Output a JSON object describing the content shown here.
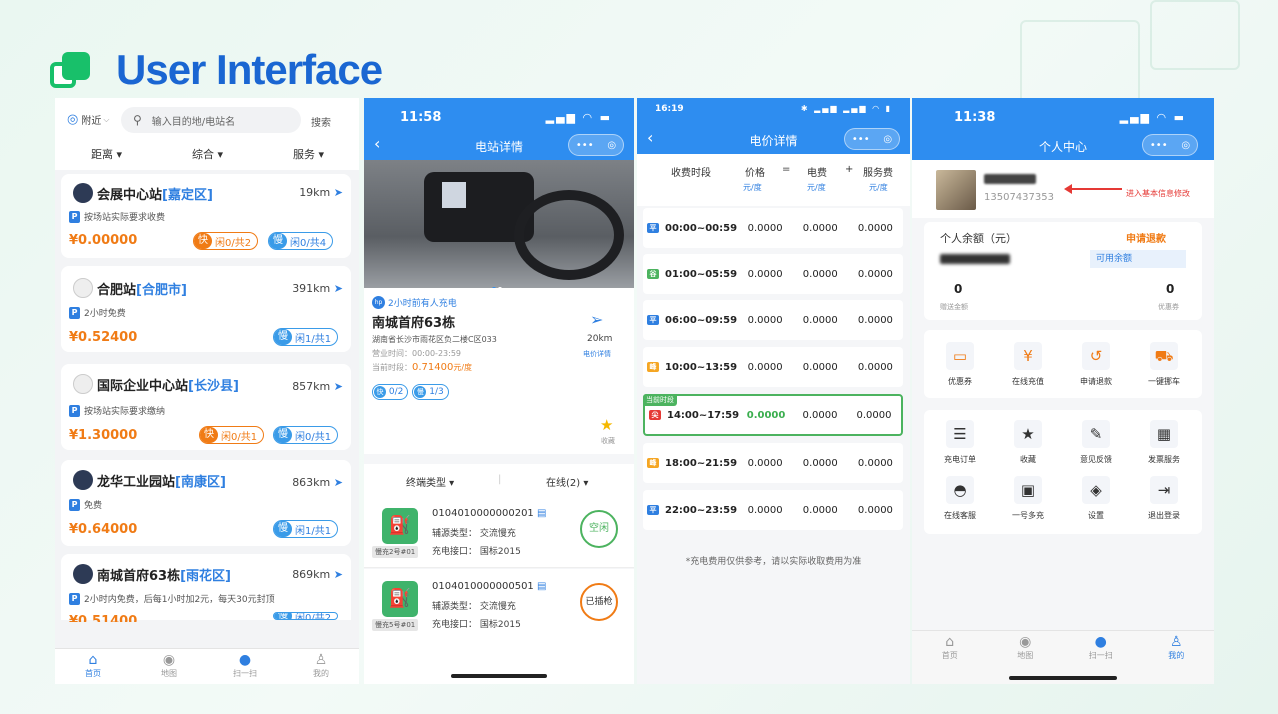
{
  "page_title": "User Interface",
  "colors": {
    "accent": "#2e8df0",
    "brand_green": "#18c06a",
    "title_blue": "#1a66d2",
    "price_orange": "#f07b15"
  },
  "p1": {
    "location": "附近",
    "search_placeholder": "输入目的地/电站名",
    "search_btn": "搜索",
    "filters": [
      "距离",
      "综合",
      "服务"
    ],
    "stations": [
      {
        "name": "会展中心站",
        "district": "[嘉定区]",
        "dist": "19km",
        "note": "按场站实际要求收费",
        "price": "¥0.00000",
        "fast": "闲0/共2",
        "slow": "闲0/共4"
      },
      {
        "name": "合肥站",
        "district": "[合肥市]",
        "dist": "391km",
        "note": "2小时免费",
        "price": "¥0.52400",
        "fast": "",
        "slow": "闲1/共1"
      },
      {
        "name": "国际企业中心站",
        "district": "[长沙县]",
        "dist": "857km",
        "note": "按场站实际要求缴纳",
        "price": "¥1.30000",
        "fast": "闲0/共1",
        "slow": "闲0/共1"
      },
      {
        "name": "龙华工业园站",
        "district": "[南康区]",
        "dist": "863km",
        "note": "免费",
        "price": "¥0.64000",
        "fast": "",
        "slow": "闲1/共1"
      },
      {
        "name": "南城首府63栋",
        "district": "[雨花区]",
        "dist": "869km",
        "note": "2小时内免费，后每1小时加2元，每天30元封顶",
        "price": "¥0.51400",
        "fast": "",
        "slow": "闲0/共2"
      }
    ],
    "fast_key": "快",
    "slow_key": "慢",
    "tabs": [
      "首页",
      "地图",
      "扫一扫",
      "我的"
    ]
  },
  "p2": {
    "time": "11:58",
    "title": "电站详情",
    "recent": "2小时前有人充电",
    "station": "南城首府63栋",
    "address": "湖南省长沙市雨花区负二楼C区033",
    "hours": "营业时间：00:00-23:59",
    "cur_label": "当前时段：",
    "cur_price": "0.71400",
    "cur_unit": "元/度",
    "dist": "20km",
    "price_detail": "电价详情",
    "fast_cnt": "0/2",
    "slow_cnt": "1/3",
    "fav": "收藏",
    "filter1": "终端类型",
    "filter2": "在线(2)",
    "terminals": [
      {
        "id": "0104010000000201",
        "type_label": "辅源类型：",
        "type": "交流慢充",
        "port_label": "充电接口：",
        "port": "国标2015",
        "tag": "慢充2号#01",
        "status": "空闲"
      },
      {
        "id": "0104010000000501",
        "type_label": "辅源类型：",
        "type": "交流慢充",
        "port_label": "充电接口：",
        "port": "国标2015",
        "tag": "慢充5号#01",
        "status": "已插枪"
      }
    ]
  },
  "p3": {
    "time": "16:19",
    "title": "电价详情",
    "headers": [
      "收费时段",
      "价格",
      "=",
      "电费",
      "+",
      "服务费"
    ],
    "units": [
      "元/度",
      "元/度",
      "元/度"
    ],
    "current_label": "当前时段",
    "rows": [
      {
        "icon": "平",
        "time": "00:00~00:59",
        "price": "0.0000",
        "elec": "0.0000",
        "service": "0.0000"
      },
      {
        "icon": "谷",
        "time": "01:00~05:59",
        "price": "0.0000",
        "elec": "0.0000",
        "service": "0.0000"
      },
      {
        "icon": "平",
        "time": "06:00~09:59",
        "price": "0.0000",
        "elec": "0.0000",
        "service": "0.0000"
      },
      {
        "icon": "峰",
        "time": "10:00~13:59",
        "price": "0.0000",
        "elec": "0.0000",
        "service": "0.0000"
      },
      {
        "icon": "尖",
        "time": "14:00~17:59",
        "price": "0.0000",
        "elec": "0.0000",
        "service": "0.0000"
      },
      {
        "icon": "峰",
        "time": "18:00~21:59",
        "price": "0.0000",
        "elec": "0.0000",
        "service": "0.0000"
      },
      {
        "icon": "平",
        "time": "22:00~23:59",
        "price": "0.0000",
        "elec": "0.0000",
        "service": "0.0000"
      }
    ],
    "footnote": "*充电费用仅供参考，请以实际收取费用为准"
  },
  "p4": {
    "time": "11:38",
    "title": "个人中心",
    "phone": "13507437353",
    "edit_hint": "进入基本信息修改",
    "balance_label": "个人余额（元）",
    "refund": "申请退款",
    "available": "可用余额",
    "gift_value": "0",
    "gift_label": "赠送金额",
    "coupon_value": "0",
    "coupon_label": "优惠券",
    "grid1": [
      {
        "icon": "ticket-icon",
        "label": "优惠券"
      },
      {
        "icon": "wallet-icon",
        "label": "在线充值"
      },
      {
        "icon": "refund-icon",
        "label": "申请退款"
      },
      {
        "icon": "car-icon",
        "label": "一键挪车"
      }
    ],
    "grid2": [
      {
        "icon": "order-icon",
        "label": "充电订单"
      },
      {
        "icon": "star-icon",
        "label": "收藏"
      },
      {
        "icon": "edit-icon",
        "label": "意见反馈"
      },
      {
        "icon": "invoice-icon",
        "label": "发票服务"
      },
      {
        "icon": "headset-icon",
        "label": "在线客服"
      },
      {
        "icon": "multi-charge-icon",
        "label": "一号多充"
      },
      {
        "icon": "settings-icon",
        "label": "设置"
      },
      {
        "icon": "logout-icon",
        "label": "退出登录"
      }
    ],
    "tabs": [
      "首页",
      "地图",
      "扫一扫",
      "我的"
    ]
  }
}
